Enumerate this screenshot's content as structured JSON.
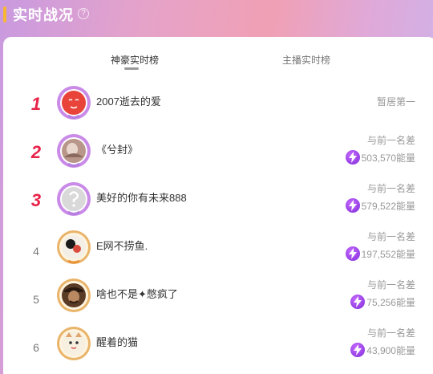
{
  "header": {
    "title": "实时战况",
    "help_glyph": "?"
  },
  "tabs": [
    {
      "label": "神豪实时榜",
      "active": true
    },
    {
      "label": "主播实时榜",
      "active": false
    }
  ],
  "rows": [
    {
      "rank": "1",
      "name": "2007逝去的爱",
      "status": "暂居第一",
      "avatar": "red-face-avatar"
    },
    {
      "rank": "2",
      "name": "《兮封》",
      "gap_label": "与前一名差",
      "gap_value": "503,570能量",
      "avatar": "photo-avatar"
    },
    {
      "rank": "3",
      "name": "美好的你有未来888",
      "gap_label": "与前一名差",
      "gap_value": "579,522能量",
      "avatar": "placeholder-avatar"
    },
    {
      "rank": "4",
      "name": "E网不捞鱼.",
      "gap_label": "与前一名差",
      "gap_value": "197,552能量",
      "avatar": "cartoon-avatar"
    },
    {
      "rank": "5",
      "name": "啥也不是✦憋疯了",
      "gap_label": "与前一名差",
      "gap_value": "75,256能量",
      "avatar": "pirate-avatar"
    },
    {
      "rank": "6",
      "name": "醒着的猫",
      "gap_label": "与前一名差",
      "gap_value": "43,900能量",
      "avatar": "cat-avatar"
    }
  ],
  "colors": {
    "accent": "#f7b733",
    "rank_top": "#e8234a",
    "energy_icon": "#8a3be0"
  }
}
